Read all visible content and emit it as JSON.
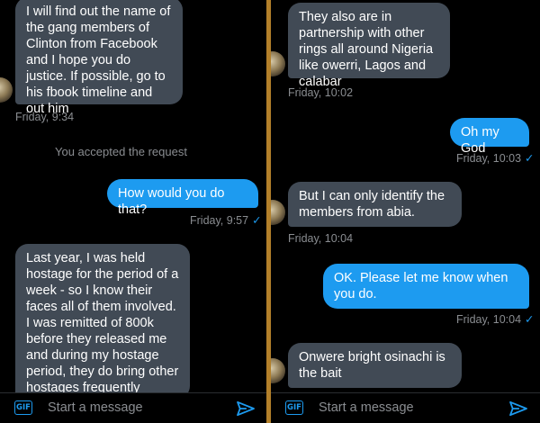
{
  "left": {
    "messages": {
      "m1": "I will find out the name of the gang members of Clinton from Facebook and I hope you do justice. If possible, go to his fbook timeline and out him",
      "m1_time": "Friday, 9:34",
      "system_note": "You accepted the request",
      "m2": "How would you do that?",
      "m2_time": "Friday, 9:57",
      "m3": "Last year, I was held hostage for the period of a week - so I know their faces all of them involved. I was remitted of 800k before they released me and during my hostage period, they do bring other hostages frequently"
    },
    "composer": {
      "gif_label": "GIF",
      "placeholder": "Start a message"
    }
  },
  "right": {
    "messages": {
      "m1": "They also are in partnership with other rings all around Nigeria like owerri, Lagos and calabar",
      "m1_time": "Friday, 10:02",
      "m2": "Oh my God",
      "m2_time": "Friday, 10:03",
      "m3": "But I can only identify the members from abia.",
      "m3_time": "Friday, 10:04",
      "m4": "OK. Please let me know when you do.",
      "m4_time": "Friday, 10:04",
      "m5": "Onwere bright osinachi is the bait"
    },
    "composer": {
      "gif_label": "GIF",
      "placeholder": "Start a message"
    }
  },
  "icons": {
    "read_check": "✓",
    "send": "send-icon",
    "gif": "gif-icon"
  },
  "colors": {
    "accent": "#1d9bf0",
    "received_bubble": "#414a55",
    "divider": "#b3802a",
    "background": "#000000"
  }
}
